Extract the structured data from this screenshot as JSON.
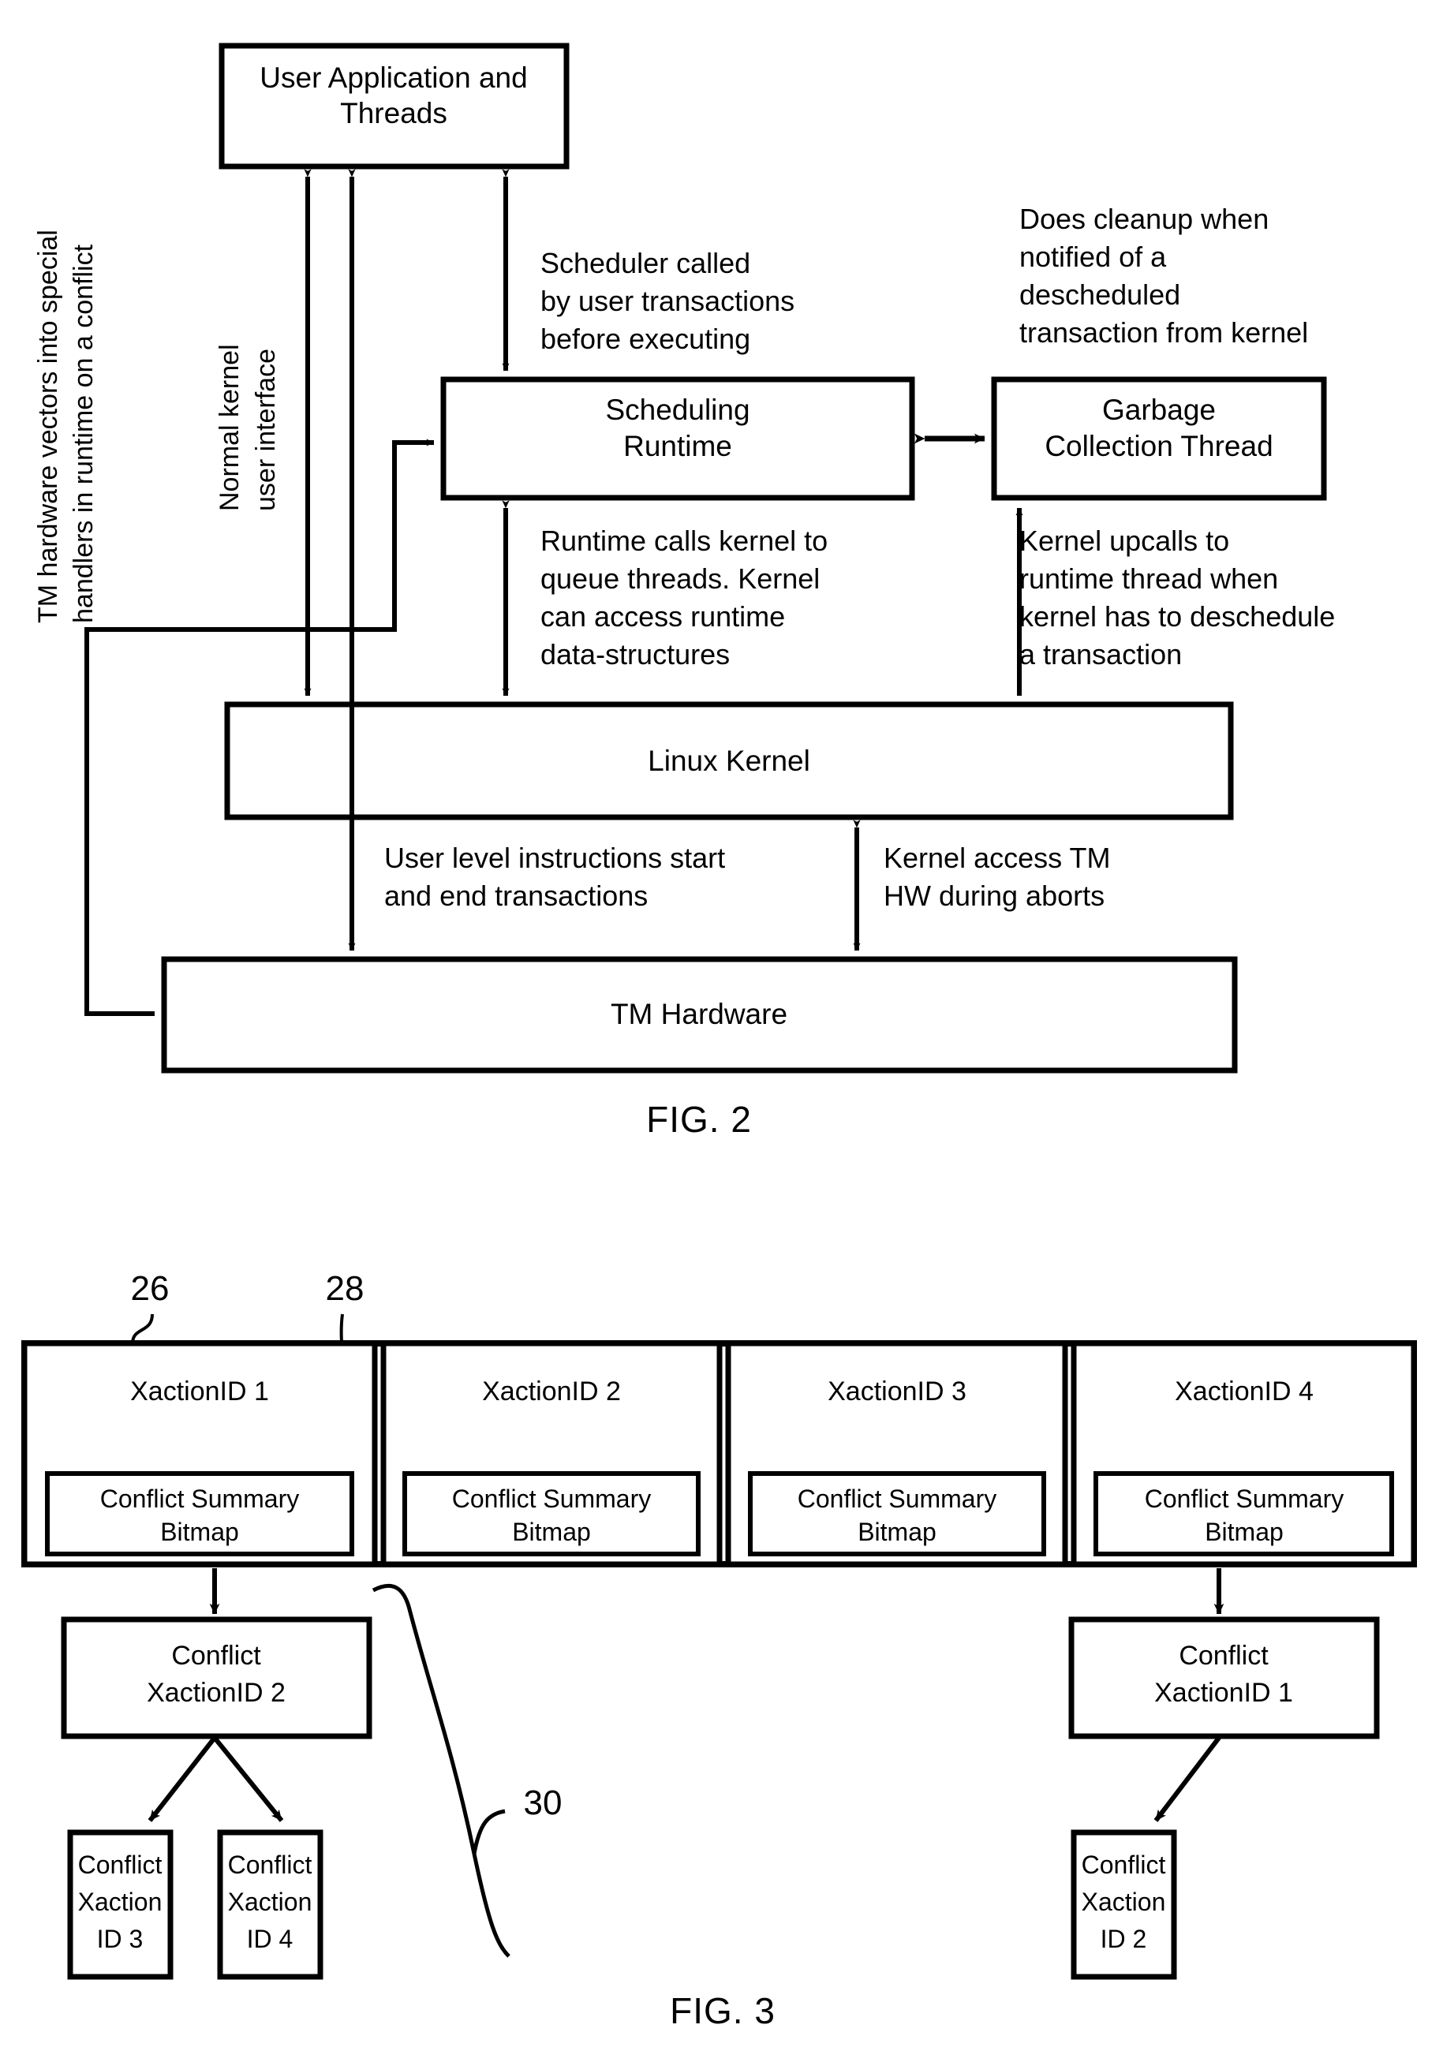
{
  "figure2": {
    "caption": "FIG. 2",
    "boxes": {
      "user_app_line1": "User Application and",
      "user_app_line2": "Threads",
      "scheduling_line1": "Scheduling",
      "scheduling_line2": "Runtime",
      "gc_line1": "Garbage",
      "gc_line2": "Collection Thread",
      "linux_kernel": "Linux Kernel",
      "tm_hardware": "TM Hardware"
    },
    "annotations": {
      "scheduler_called": [
        "Scheduler called",
        "by user transactions",
        "before executing"
      ],
      "does_cleanup": [
        "Does cleanup when",
        "notified of a",
        "descheduled",
        "transaction from kernel"
      ],
      "runtime_calls": [
        "Runtime calls kernel to",
        "queue threads. Kernel",
        "can access runtime",
        "data-structures"
      ],
      "kernel_upcalls": [
        "Kernel upcalls to",
        "runtime thread when",
        "kernel has to deschedule",
        "a transaction"
      ],
      "user_level": [
        "User level instructions start",
        "and end transactions"
      ],
      "kernel_access": [
        "Kernel access TM",
        "HW during aborts"
      ],
      "normal_kernel": [
        "Normal kernel",
        "user interface"
      ],
      "tm_vectors": [
        "TM hardware vectors into special",
        "handlers in runtime on a conflict"
      ]
    }
  },
  "figure3": {
    "caption": "FIG. 3",
    "numerals": {
      "table": "26",
      "bitmap": "28",
      "list": "30"
    },
    "bitmap_label": [
      "Conflict Summary",
      "Bitmap"
    ],
    "cells": [
      {
        "title": "XactionID 1"
      },
      {
        "title": "XactionID 2"
      },
      {
        "title": "XactionID 3"
      },
      {
        "title": "XactionID 4"
      }
    ],
    "left_tree": {
      "root": [
        "Conflict",
        "XactionID 2"
      ],
      "children": [
        [
          "Conflict",
          "Xaction",
          "ID 3"
        ],
        [
          "Conflict",
          "Xaction",
          "ID 4"
        ]
      ]
    },
    "right_tree": {
      "root": [
        "Conflict",
        "XactionID 1"
      ],
      "children": [
        [
          "Conflict",
          "Xaction",
          "ID 2"
        ]
      ]
    }
  }
}
